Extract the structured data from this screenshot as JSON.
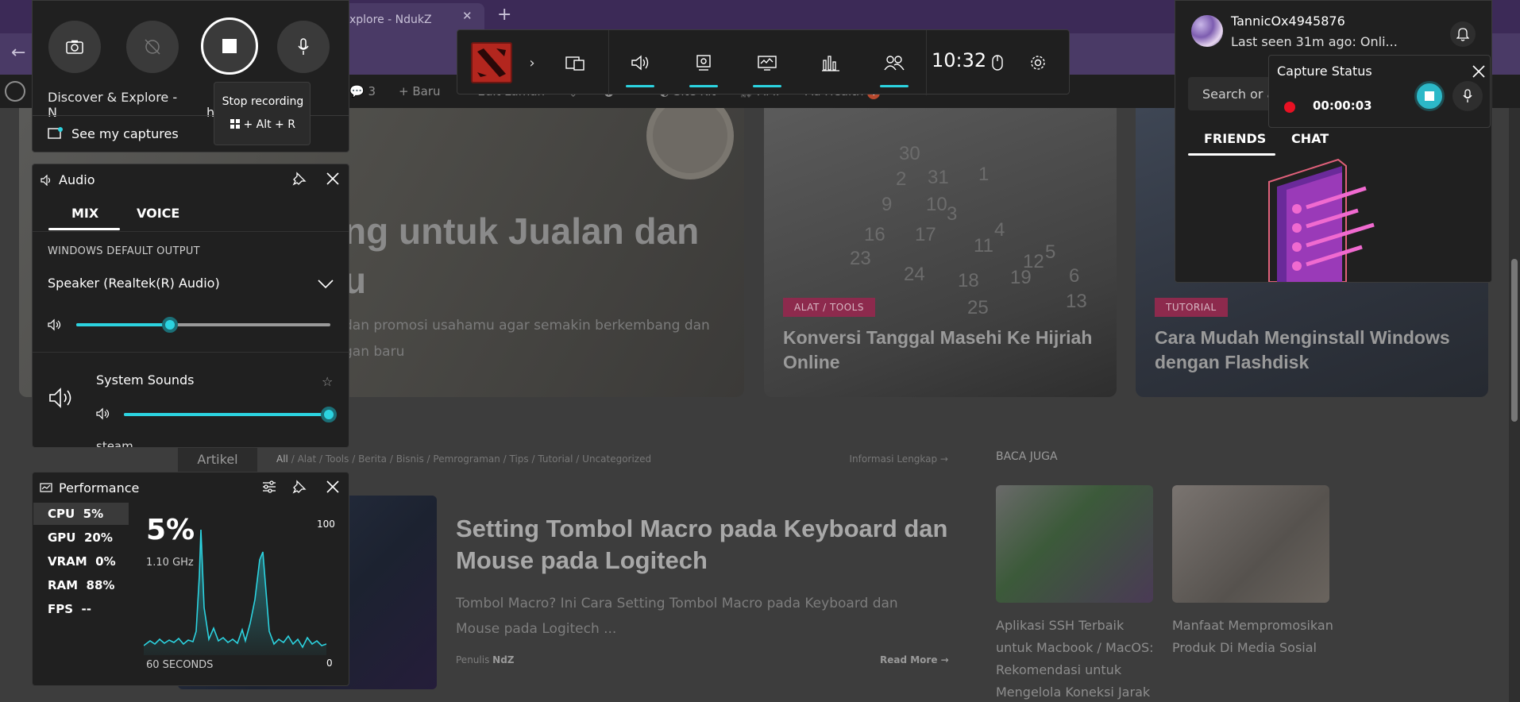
{
  "browser": {
    "tab_title": "xplore - NdukZ",
    "wp_bar": {
      "comments_count": "3",
      "new_label": "Baru",
      "edit_label": "Edit Laman",
      "sitekit_label": "Site Kit",
      "amp_label": "AMP",
      "adhealth_label": "Ad Health",
      "adhealth_badge": "!"
    }
  },
  "page": {
    "hero": {
      "title_line1": "ng untuk Jualan dan",
      "title_line2": "u",
      "desc_line1": "dan promosi usahamu agar semakin berkembang dan",
      "desc_line2": "gan baru"
    },
    "cards": [
      {
        "badge": "ALAT / TOOLS",
        "title": "Konversi Tanggal Masehi Ke Hijriah Online"
      },
      {
        "badge": "TUTORIAL",
        "title": "Cara Mudah Menginstall Windows dengan Flashdisk"
      }
    ],
    "filter": {
      "artikel": "Artikel",
      "categories": [
        "All",
        "Alat / Tools",
        "Berita",
        "Bisnis",
        "Pemrograman",
        "Tips",
        "Tutorial",
        "Uncategorized"
      ],
      "info": "Informasi Lengkap →"
    },
    "post": {
      "title": "Setting Tombol Macro pada Keyboard dan Mouse pada Logitech",
      "desc": "Tombol Macro? Ini Cara Setting Tombol Macro pada Keyboard dan Mouse pada Logitech ...",
      "author_prefix": "Penulis",
      "author": "NdZ",
      "read_more": "Read More →"
    },
    "baca_juga": {
      "heading": "BACA JUGA",
      "items": [
        {
          "title": "Aplikasi SSH Terbaik untuk Macbook / MacOS: Rekomendasi untuk Mengelola Koneksi Jarak"
        },
        {
          "title": "Manfaat Mempromosikan Produk Di Media Sosial"
        }
      ]
    }
  },
  "capture": {
    "window_title": "Discover & Explore - N",
    "window_title_tail": "hrome",
    "see_captures": "See my captures",
    "tooltip_title": "Stop recording",
    "tooltip_shortcut": "+ Alt + R"
  },
  "topbar": {
    "time": "10:32"
  },
  "audio": {
    "title": "Audio",
    "tabs": [
      "MIX",
      "VOICE"
    ],
    "output_label": "WINDOWS DEFAULT OUTPUT",
    "device": "Speaker (Realtek(R) Audio)",
    "master_volume": 0.37,
    "system_sounds_label": "System Sounds",
    "system_sounds_volume": 1.0,
    "steam_label": "steam"
  },
  "performance": {
    "title": "Performance",
    "rows": [
      {
        "label": "CPU",
        "value": "5%"
      },
      {
        "label": "GPU",
        "value": "20%"
      },
      {
        "label": "VRAM",
        "value": "0%"
      },
      {
        "label": "RAM",
        "value": "88%"
      },
      {
        "label": "FPS",
        "value": "--"
      }
    ],
    "big_value": "5%",
    "freq": "1.10 GHz",
    "max_label": "100",
    "min_label": "0",
    "time_label": "60 SECONDS"
  },
  "social": {
    "username": "TannicOx4945876",
    "last_seen": "Last seen 31m ago: Onli...",
    "search_placeholder": "Search or a",
    "tabs": [
      "FRIENDS",
      "CHAT"
    ]
  },
  "capture_status": {
    "title": "Capture Status",
    "elapsed": "00:00:03"
  },
  "colors": {
    "accent": "#2cd3e0",
    "record": "#e81123",
    "panel": "#202020"
  }
}
